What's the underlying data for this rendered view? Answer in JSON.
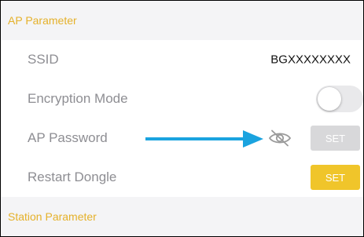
{
  "ap_section": {
    "title": "AP Parameter",
    "rows": [
      {
        "label": "SSID",
        "value": "BGXXXXXXXX"
      },
      {
        "label": "Encryption Mode",
        "toggle_on": false
      },
      {
        "label": "AP Password",
        "button_label": "SET",
        "button_enabled": false,
        "icon": "eye-slash-icon"
      },
      {
        "label": "Restart Dongle",
        "button_label": "SET",
        "button_enabled": true
      }
    ]
  },
  "station_section": {
    "title": "Station Parameter"
  },
  "colors": {
    "section_title": "#e5b12a",
    "section_bg": "#f4f4f6",
    "button_active": "#f0c52a",
    "button_disabled": "#d8d8da",
    "annotation_arrow": "#1aa3df"
  }
}
